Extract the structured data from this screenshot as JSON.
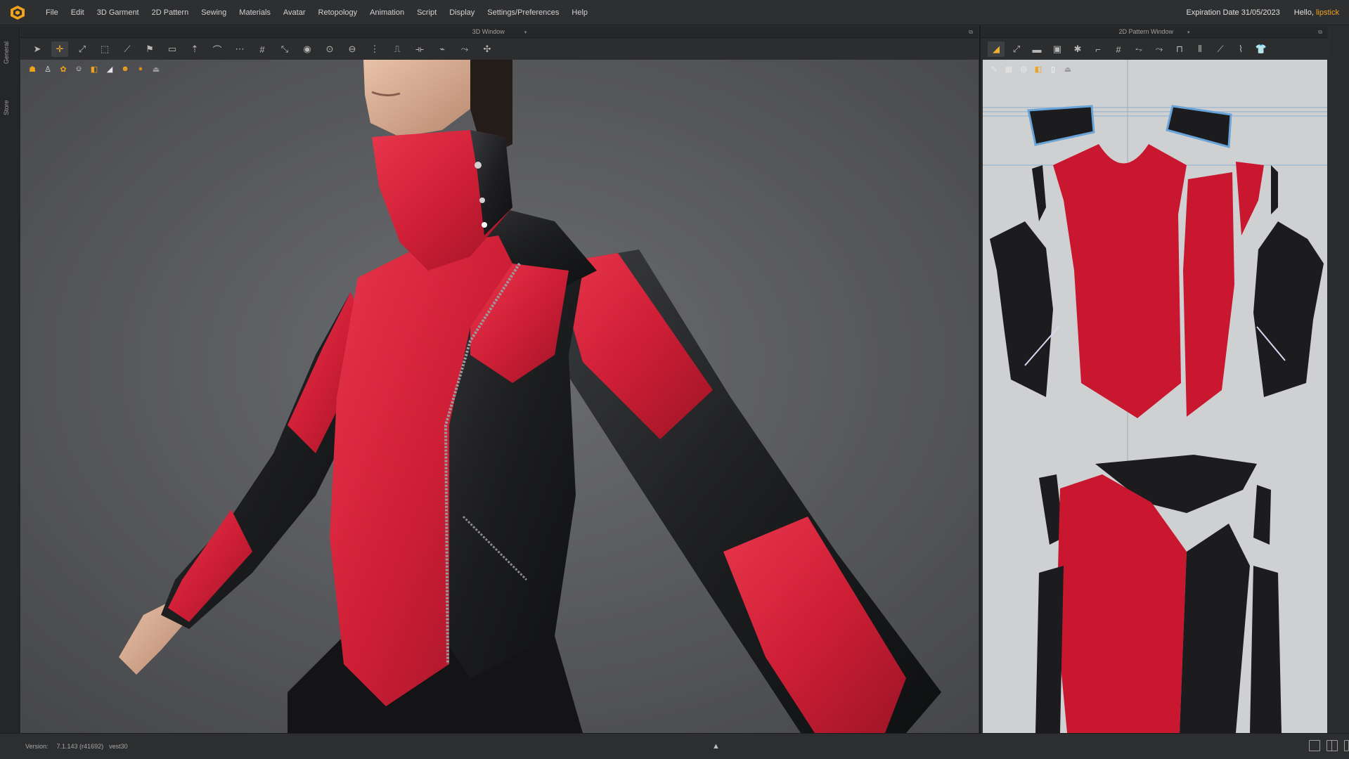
{
  "menubar": {
    "items": [
      "File",
      "Edit",
      "3D Garment",
      "2D Pattern",
      "Sewing",
      "Materials",
      "Avatar",
      "Retopology",
      "Animation",
      "Script",
      "Display",
      "Settings/Preferences",
      "Help"
    ],
    "expiration": "Expiration Date 31/05/2023",
    "greeting": "Hello,",
    "username": "lipstick"
  },
  "left_tabs": {
    "general": "General",
    "store": "Store"
  },
  "window3d": {
    "title": "3D Window",
    "toolbar_icons": [
      "select-move-icon",
      "add-point-icon",
      "edit-point-icon",
      "select-mesh-icon",
      "pin-icon",
      "fold-icon",
      "tape-icon",
      "gravity-icon",
      "trim-icon",
      "stitch-icon",
      "grid-icon",
      "measure-icon",
      "steam-icon",
      "button-icon",
      "buttonhole-icon",
      "zipper-icon",
      "sewing-icon",
      "bond-icon",
      "arrangement-icon",
      "puckering-icon",
      "line-length-icon"
    ],
    "subtoolbar_icons": [
      "show-avatar-icon",
      "show-garment-icon",
      "show-pattern-icon",
      "avatar-body-icon",
      "texture-icon",
      "strain-map-icon",
      "skin-icon",
      "sphere-icon",
      "export-icon"
    ]
  },
  "window2d": {
    "title": "2D Pattern Window",
    "toolbar_icons": [
      "transform-pattern-icon",
      "edit-pattern-icon",
      "rectangle-icon",
      "internal-shape-icon",
      "add-point-icon",
      "trace-icon",
      "grading-icon",
      "segment-sewing-icon",
      "free-sewing-icon",
      "seam-allowance-icon",
      "line-tool-icon",
      "pleats-icon",
      "edit-curvature-icon",
      "shirt-icon"
    ],
    "subtoolbar_icons": [
      "pen-icon",
      "pattern-layer-icon",
      "fabric-icon",
      "texture-icon",
      "white-page-icon",
      "export-pattern-icon"
    ]
  },
  "statusbar": {
    "version_label": "Version:",
    "version_value": "7.1.143 (r41692)",
    "user": "vest30"
  },
  "colors": {
    "fabric_red": "#d21e35",
    "fabric_black": "#1c1c1e",
    "accent": "#f2a31c",
    "viewport_bg": "#5d5e61",
    "pattern_bg": "#cfd0d2"
  }
}
